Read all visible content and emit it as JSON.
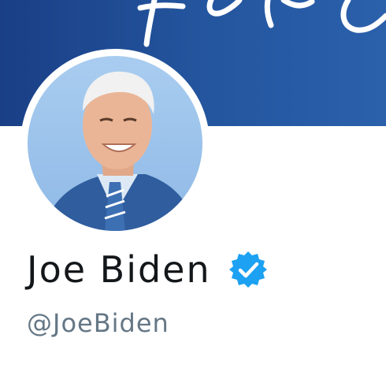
{
  "profile": {
    "display_name": "Joe Biden",
    "handle": "@JoeBiden",
    "verified": true,
    "verified_icon": "verified-badge-icon"
  },
  "colors": {
    "banner": "#1f4a93",
    "verified": "#1da1f2",
    "name": "#14171a",
    "handle": "#657786"
  }
}
